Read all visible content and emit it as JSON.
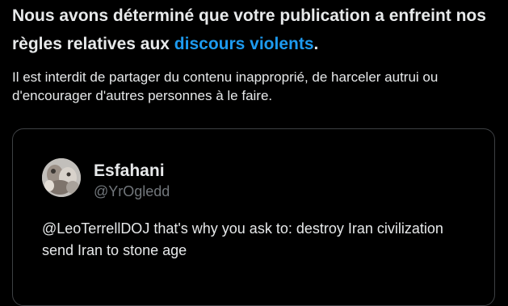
{
  "notice": {
    "headline_prefix": "Nous avons déterminé que votre publication a enfreint nos règles relatives aux ",
    "headline_link": "discours violents",
    "headline_suffix": ".",
    "description": "Il est interdit de partager du contenu inapproprié, de harceler autrui ou d'encourager d'autres personnes à le faire."
  },
  "tweet": {
    "display_name": "Esfahani",
    "handle": "@YrOgledd",
    "text": "@LeoTerrellDOJ that's why you ask to: destroy Iran civilization send Iran to stone age",
    "avatar_icon": "avatar-image"
  },
  "colors": {
    "background": "#000000",
    "text_primary": "#e7e9ea",
    "text_secondary": "#71767b",
    "link": "#1d9bf0",
    "card_border": "#3e4144"
  }
}
